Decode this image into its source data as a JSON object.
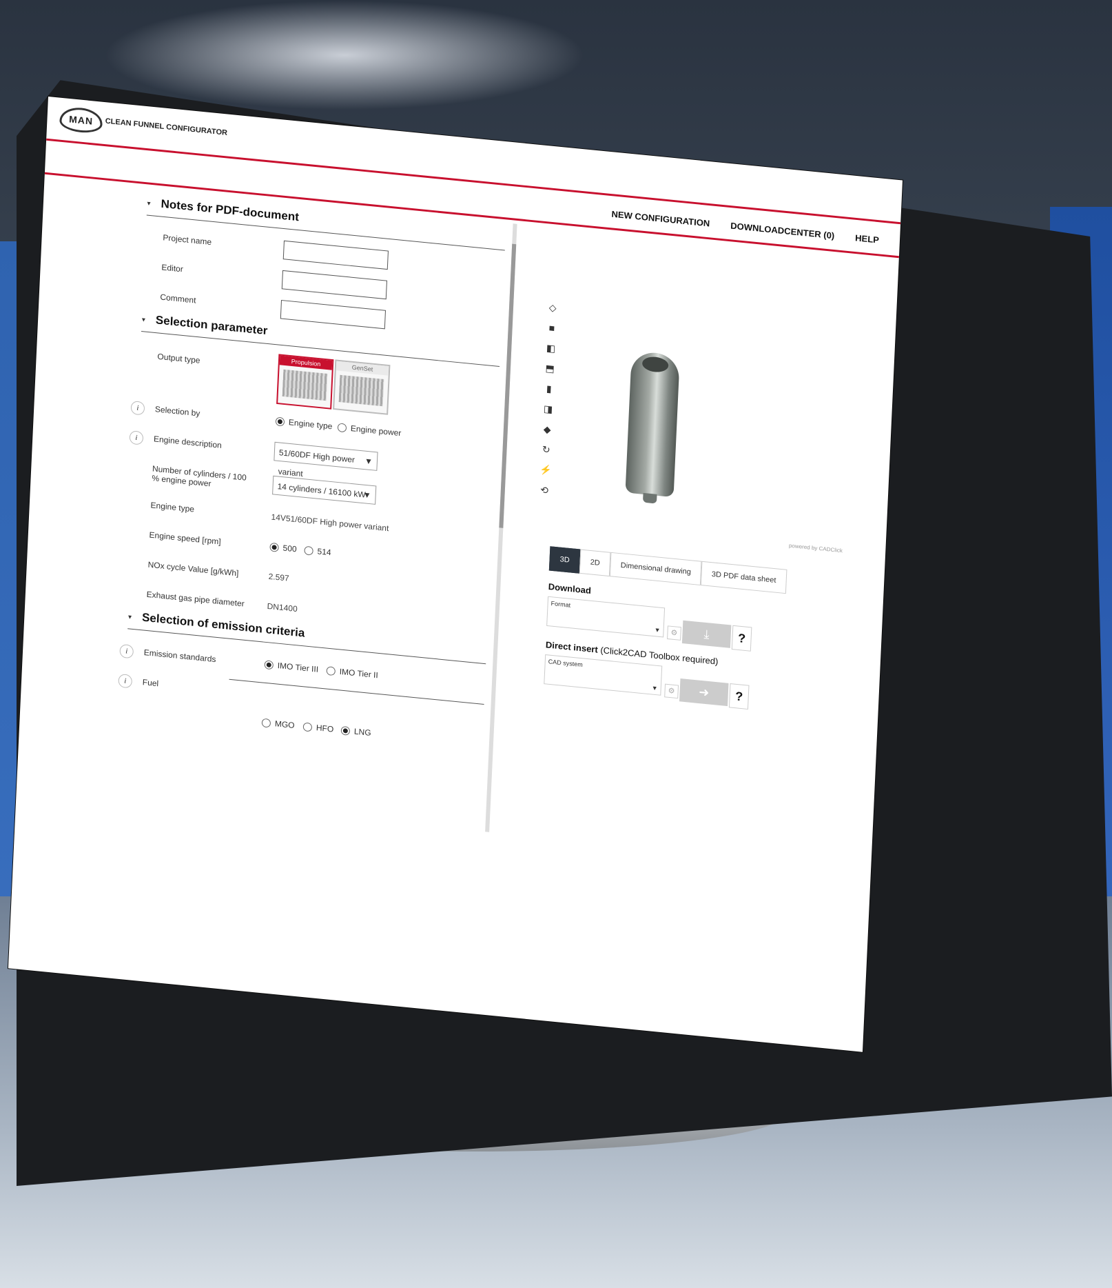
{
  "app": {
    "logo_text": "MAN",
    "title": "CLEAN FUNNEL CONFIGURATOR"
  },
  "topnav": {
    "new_configuration": "NEW CONFIGURATION",
    "downloadcenter": "DOWNLOADCENTER (0)",
    "help": "HELP"
  },
  "notes": {
    "title": "Notes for PDF-document",
    "project_name_label": "Project name",
    "editor_label": "Editor",
    "comment_label": "Comment"
  },
  "selection": {
    "title": "Selection parameter",
    "output_type_label": "Output type",
    "output_types": [
      "Propulsion",
      "GenSet"
    ],
    "selection_by_label": "Selection by",
    "selection_by_options": [
      "Engine type",
      "Engine power"
    ],
    "engine_description_label": "Engine description",
    "engine_description_value": "51/60DF High power variant",
    "cylinders_label": "Number of cylinders / 100 % engine power",
    "cylinders_value": "14 cylinders / 16100 kW",
    "engine_type_label": "Engine type",
    "engine_type_value": "14V51/60DF High power variant",
    "engine_speed_label": "Engine speed [rpm]",
    "engine_speed_options": [
      "500",
      "514"
    ],
    "nox_label": "NOx cycle Value [g/kWh]",
    "nox_value": "2.597",
    "exhaust_label": "Exhaust gas pipe diameter",
    "exhaust_value": "DN1400"
  },
  "emission": {
    "title": "Selection of emission criteria",
    "standards_label": "Emission standards",
    "standards_options": [
      "IMO Tier III",
      "IMO Tier II"
    ],
    "fuel_label": "Fuel",
    "fuel_options": [
      "MGO",
      "HFO",
      "LNG"
    ]
  },
  "viewer": {
    "powered_by": "powered by CADClick",
    "tabs": [
      "3D",
      "2D",
      "Dimensional drawing",
      "3D PDF data sheet"
    ],
    "icons": [
      "cube-iso-icon",
      "cube-front-icon",
      "cube-side-icon",
      "cube-top-icon",
      "cube-back-icon",
      "cube-right-icon",
      "cube-bottom-icon",
      "rotate-icon",
      "lightning-icon",
      "3d-rotate-icon"
    ]
  },
  "download": {
    "title": "Download",
    "format_placeholder": "Format",
    "direct_insert_title": "Direct insert",
    "direct_insert_note": "(Click2CAD Toolbox required)",
    "cad_placeholder": "CAD system",
    "help_symbol": "?",
    "download_icon": "download-icon",
    "arrow_icon": "arrow-right-icon"
  },
  "colors": {
    "accent": "#c8102e",
    "active_tab": "#2d3640"
  }
}
